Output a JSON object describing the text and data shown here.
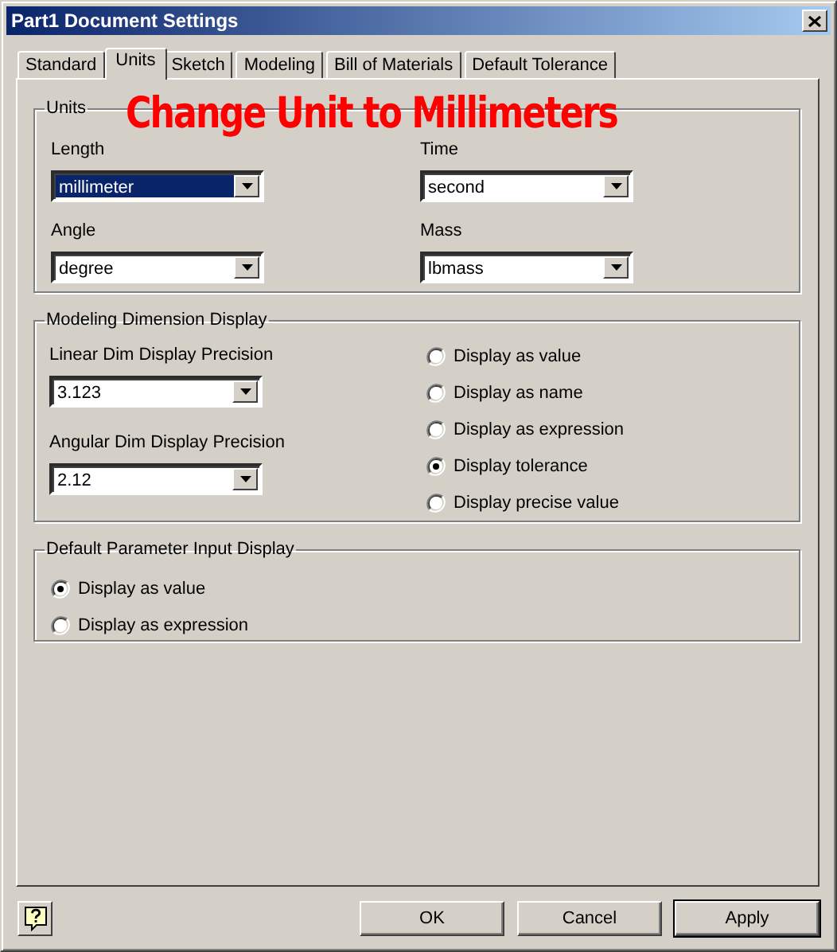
{
  "window": {
    "title": "Part1 Document Settings"
  },
  "tabs": [
    {
      "label": "Standard",
      "selected": false
    },
    {
      "label": "Units",
      "selected": true
    },
    {
      "label": "Sketch",
      "selected": false
    },
    {
      "label": "Modeling",
      "selected": false
    },
    {
      "label": "Bill of Materials",
      "selected": false
    },
    {
      "label": "Default Tolerance",
      "selected": false
    }
  ],
  "annotation": {
    "text": "Change Unit to Millimeters",
    "color": "#ff0000"
  },
  "units_group": {
    "title": "Units",
    "fields": [
      {
        "label": "Length",
        "value": "millimeter",
        "highlighted": true
      },
      {
        "label": "Time",
        "value": "second",
        "highlighted": false
      },
      {
        "label": "Angle",
        "value": "degree",
        "highlighted": false
      },
      {
        "label": "Mass",
        "value": "lbmass",
        "highlighted": false
      }
    ]
  },
  "modeling_group": {
    "title": "Modeling Dimension Display",
    "fields": [
      {
        "label": "Linear Dim Display Precision",
        "value": "3.123",
        "highlighted": false
      },
      {
        "label": "Angular Dim Display Precision",
        "value": "2.12",
        "highlighted": false
      }
    ],
    "options": [
      {
        "label": "Display as value",
        "selected": false
      },
      {
        "label": "Display as name",
        "selected": false
      },
      {
        "label": "Display as expression",
        "selected": false
      },
      {
        "label": "Display tolerance",
        "selected": true
      },
      {
        "label": "Display precise value",
        "selected": false
      }
    ]
  },
  "parameter_group": {
    "title": "Default Parameter Input Display",
    "options": [
      {
        "label": "Display as value",
        "selected": true
      },
      {
        "label": "Display as expression",
        "selected": false
      }
    ]
  },
  "buttons": [
    {
      "label": "OK",
      "default": false
    },
    {
      "label": "Cancel",
      "default": false
    },
    {
      "label": "Apply",
      "default": true
    }
  ]
}
